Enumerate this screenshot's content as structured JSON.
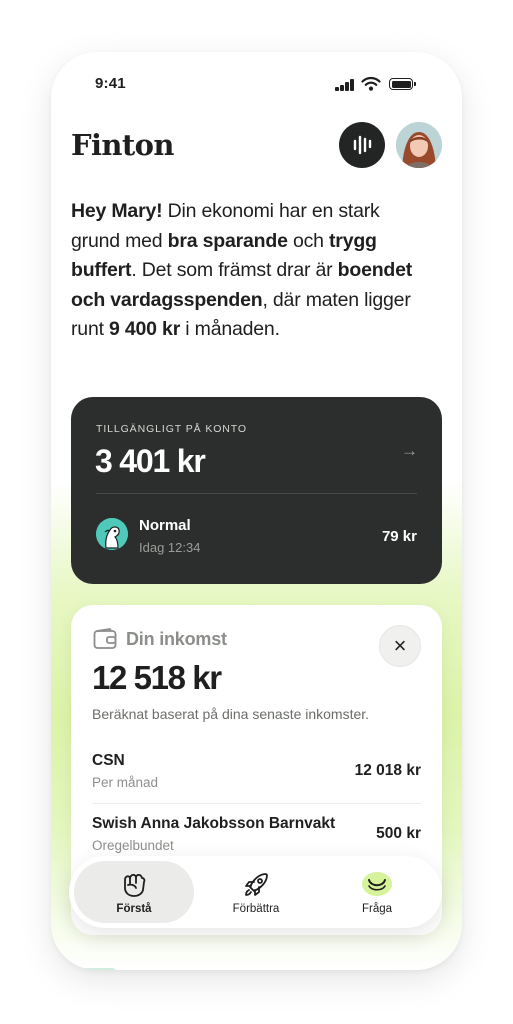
{
  "status_bar": {
    "time": "9:41"
  },
  "header": {
    "logo": "Finton"
  },
  "intro": {
    "greeting": "Hey Mary!",
    "t1": " Din ekonomi har en stark grund med ",
    "b1": "bra sparande",
    "t2": " och ",
    "b2": "trygg buffert",
    "t3": ". Det som främst drar är ",
    "b3": "boendet och vardagsspenden",
    "t4": ", där maten ligger runt ",
    "b4": "9 400 kr",
    "t5": " i månaden."
  },
  "balance_card": {
    "label": "TILLGÄNGLIGT PÅ KONTO",
    "amount": "3 401 kr",
    "arrow": "→",
    "plan_name": "Normal",
    "plan_time": "Idag 12:34",
    "plan_amount": "79 kr"
  },
  "income_card": {
    "title": "Din inkomst",
    "close": "×",
    "amount": "12 518 kr",
    "note": "Beräknat baserat på dina senaste inkomster.",
    "rows": [
      {
        "title": "CSN",
        "subtitle": "Per månad",
        "value": "12 018 kr"
      },
      {
        "title": "Swish Anna Jakobsson Barnvakt",
        "subtitle": "Oregelbundet",
        "value": "500 kr"
      }
    ]
  },
  "tabs": [
    {
      "label": "Förstå",
      "icon": "fist-icon",
      "active": true
    },
    {
      "label": "Förbättra",
      "icon": "rocket-icon",
      "active": false
    },
    {
      "label": "Fråga",
      "icon": "smile-icon",
      "active": false
    }
  ],
  "colors": {
    "accent_green": "#d6f29a",
    "dark_card": "#2c2e2d",
    "teal": "#4fc9ba"
  }
}
